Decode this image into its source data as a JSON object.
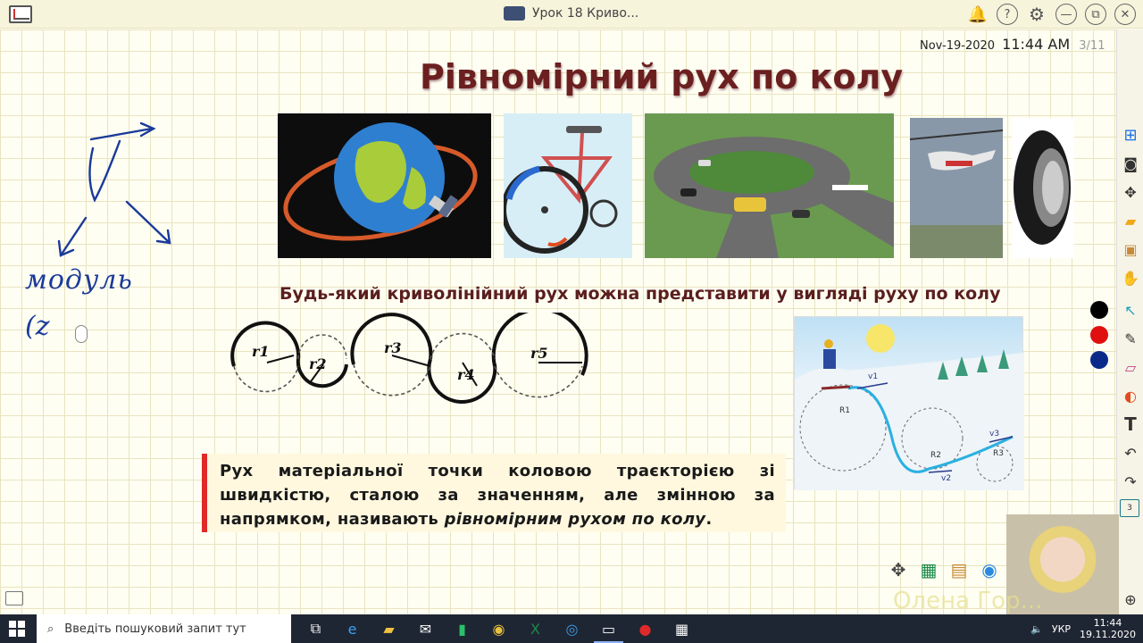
{
  "titlebar": {
    "doc_title": "Урок 18 Криво...",
    "icons": [
      "bell-icon",
      "help-icon",
      "gear-icon",
      "minimize-icon",
      "restore-icon",
      "close-icon"
    ],
    "help_glyph": "?",
    "minimize_glyph": "—",
    "restore_glyph": "⧉",
    "close_glyph": "✕"
  },
  "header": {
    "date": "Nov-19-2020",
    "time": "11:44 AM",
    "page": "3/11"
  },
  "slide": {
    "title": "Рівномірний рух по колу",
    "subtitle": "Будь-який криволінійний рух можна представити у вигляді руху по колу",
    "radii": [
      "r1",
      "r2",
      "r3",
      "r4",
      "r5"
    ],
    "definition_text": "Рух матеріальної точки коловою траєкторією зі швидкістю, сталою за значенням, але змінною за напрямком, називають ",
    "definition_term": "рівномірним рухом по колу",
    "definition_end": ".",
    "skier_labels": [
      "R1",
      "R2",
      "R3",
      "v1",
      "v2",
      "v3"
    ]
  },
  "handwriting": {
    "symbol": "v",
    "word": "модуль",
    "partial": "(z"
  },
  "toolbar": {
    "pen_colors": [
      "#000000",
      "#e01010",
      "#0a2a8a"
    ],
    "page_badge": "3"
  },
  "webcam": {
    "name": "Олена Гор..."
  },
  "taskbar": {
    "search_placeholder": "Введіть пошуковий запит тут",
    "language": "УКР",
    "clock_time": "11:44",
    "clock_date": "19.11.2020"
  }
}
